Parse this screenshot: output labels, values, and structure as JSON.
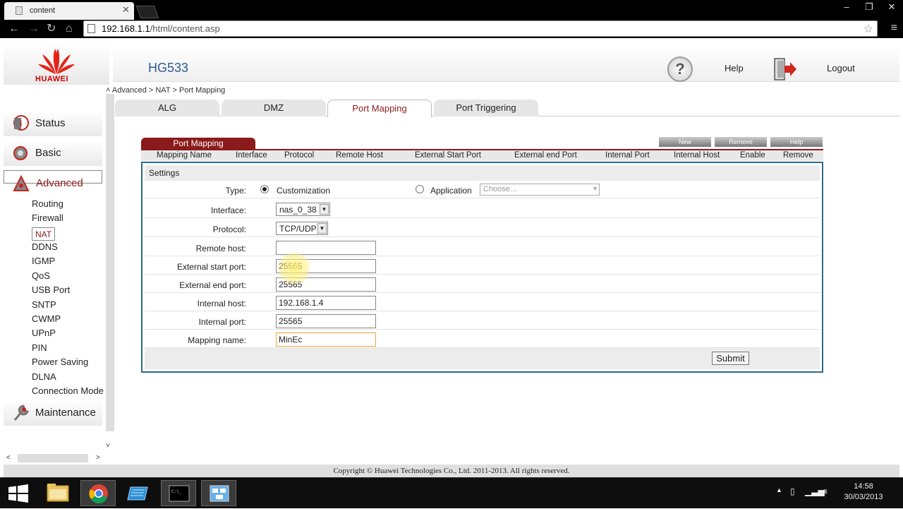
{
  "browser": {
    "tab_title": "content",
    "url_host": "192.168.1.1",
    "url_path": "/html/content.asp"
  },
  "header": {
    "brand": "HUAWEI",
    "model": "HG533",
    "help_label": "Help",
    "logout_label": "Logout"
  },
  "breadcrumb": "Advanced > NAT > Port Mapping",
  "tabs": [
    {
      "label": "ALG"
    },
    {
      "label": "DMZ"
    },
    {
      "label": "Port Mapping",
      "active": true
    },
    {
      "label": "Port Triggering"
    }
  ],
  "sidebar": {
    "categories": [
      {
        "label": "Status"
      },
      {
        "label": "Basic"
      },
      {
        "label": "Advanced",
        "selected": true
      },
      {
        "label": "Maintenance"
      }
    ],
    "advanced_items": [
      "Routing",
      "Firewall",
      "NAT",
      "DDNS",
      "IGMP",
      "QoS",
      "USB Port",
      "SNTP",
      "CWMP",
      "UPnP",
      "PIN",
      "Power Saving",
      "DLNA",
      "Connection Mode"
    ],
    "selected_item": "NAT"
  },
  "port_mapping": {
    "section_tab": "Port Mapping",
    "buttons": {
      "new": "New",
      "remove": "Remove",
      "help": "Help"
    },
    "columns": [
      "Mapping Name",
      "Interface",
      "Protocol",
      "Remote Host",
      "External Start Port",
      "External end Port",
      "Internal Port",
      "Internal Host",
      "Enable",
      "Remove"
    ]
  },
  "settings": {
    "title": "Settings",
    "type_label": "Type:",
    "type_customization": "Customization",
    "type_application": "Application",
    "application_placeholder": "Choose...",
    "interface_label": "Interface:",
    "interface_value": "nas_0_38",
    "protocol_label": "Protocol:",
    "protocol_value": "TCP/UDP",
    "remote_host_label": "Remote host:",
    "remote_host_value": "",
    "ext_start_label": "External start port:",
    "ext_start_value": "25565",
    "ext_end_label": "External end port:",
    "ext_end_value": "25565",
    "internal_host_label": "Internal host:",
    "internal_host_value": "192.168.1.4",
    "internal_port_label": "Internal port:",
    "internal_port_value": "25565",
    "mapping_name_label": "Mapping name:",
    "mapping_name_value": "MinEc",
    "submit_label": "Submit"
  },
  "footer": "Copyright © Huawei Technologies Co., Ltd. 2011-2013. All rights reserved.",
  "taskbar": {
    "time": "14:58",
    "date": "30/03/2013"
  },
  "colors": {
    "accent": "#8b1a1a",
    "frame_border": "#2d6b86",
    "model_text": "#2a5a95"
  }
}
